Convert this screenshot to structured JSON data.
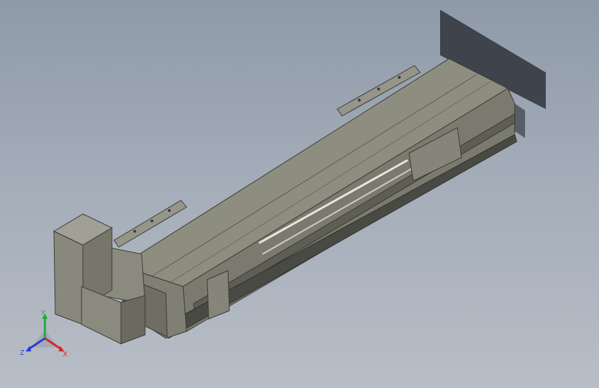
{
  "viewport": {
    "background_top": "#8f9aa9",
    "background_bottom": "#b8bec7",
    "model_color": "#8e8e80",
    "shadow_color": "#3a3f46"
  },
  "triad": {
    "y_label": "Y",
    "x_label": "X",
    "z_label": "Z",
    "y_color": "#22a83a",
    "x_color": "#d8242a",
    "z_color": "#2a3ad6"
  }
}
